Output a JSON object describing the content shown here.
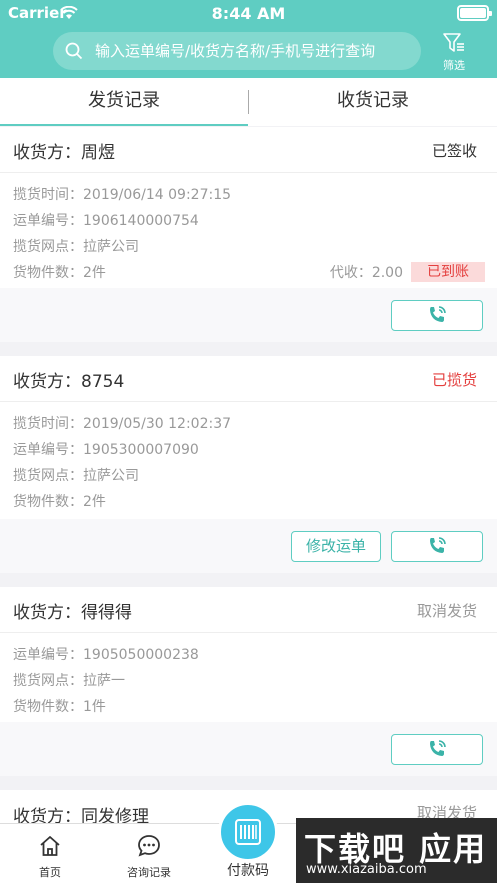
{
  "status_bar": {
    "carrier": "Carrier",
    "time": "8:44 AM"
  },
  "search": {
    "placeholder": "输入运单编号/收货方名称/手机号进行查询"
  },
  "filter": {
    "label": "筛选",
    "icon": "filter-icon"
  },
  "tabs": [
    {
      "label": "发货记录",
      "active": true
    },
    {
      "label": "收货记录",
      "active": false
    }
  ],
  "orders": [
    {
      "consignee_label": "收货方：",
      "consignee": "周煜",
      "status": "已签收",
      "status_color": "#333333",
      "rows": [
        "揽货时间：2019/06/14 09:27:15",
        "运单编号：1906140000754",
        "揽货网点：拉萨公司",
        "货物件数：2件"
      ],
      "collect": "代收：2.00",
      "badge": "已到账"
    },
    {
      "consignee_label": "收货方：",
      "consignee": "8754",
      "status": "已揽货",
      "status_color": "#e4403f",
      "rows": [
        "揽货时间：2019/05/30 12:02:37",
        "运单编号：1905300007090",
        "揽货网点：拉萨公司",
        "货物件数：2件"
      ],
      "edit_label": "修改运单"
    },
    {
      "consignee_label": "收货方：",
      "consignee": "得得得",
      "status": "取消发货",
      "status_color": "#999999",
      "rows": [
        "运单编号：1905050000238",
        "揽货网点：拉萨一",
        "货物件数：1件"
      ]
    },
    {
      "consignee_label": "收货方：",
      "consignee": "同发修理",
      "status": "取消发货",
      "status_color": "#999999"
    }
  ],
  "bottom_nav": {
    "home": "首页",
    "consult": "咨询记录",
    "pay": "付款码"
  },
  "watermark": {
    "text": "下载吧 应用",
    "url": "www.xiazaiba.com"
  }
}
